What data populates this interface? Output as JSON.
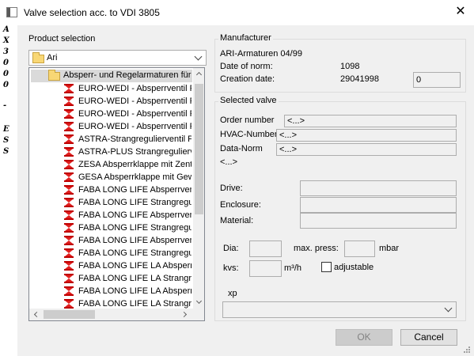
{
  "side_strip": [
    "A",
    "X",
    "3",
    "0",
    "0",
    "0",
    "-",
    "E",
    "S",
    "S"
  ],
  "window": {
    "title": "Valve selection acc. to VDI 3805",
    "close_glyph": "✕"
  },
  "product_selection": {
    "label": "Product selection",
    "combo_value": "Ari",
    "tree": {
      "root": "Absperr- und Regelarmaturen für",
      "items": [
        "EURO-WEDI - Absperrventil P",
        "EURO-WEDI - Absperrventil P",
        "EURO-WEDI - Absperrventil P",
        "EURO-WEDI - Absperrventil P",
        "ASTRA-Strangregulierventil Pl",
        "ASTRA-PLUS Strangregulierve",
        "ZESA Absperrklappe mit Zentr",
        "GESA Absperrklappe mit Gewi",
        "FABA LONG LIFE Absperrvent",
        "FABA LONG LIFE Strangreguli",
        "FABA LONG LIFE Absperrvent",
        "FABA LONG LIFE Strangreguli",
        "FABA LONG LIFE Absperrvent",
        "FABA LONG LIFE Strangreguli",
        "FABA LONG LIFE LA Absperrv",
        "FABA LONG LIFE LA Strangreg",
        "FABA LONG LIFE LA Absperrv",
        "FABA LONG LIFE LA Strangreg"
      ]
    }
  },
  "manufacturer": {
    "label": "Manufacturer",
    "name": "ARI-Armaturen 04/99",
    "date_of_norm_label": "Date of norm:",
    "date_of_norm_value": "1098",
    "creation_date_label": "Creation date:",
    "creation_date_value": "29041998",
    "extra_value": "0"
  },
  "selected_valve": {
    "label": "Selected valve",
    "order_number_label": "Order number",
    "order_number_value": "<...>",
    "hvac_number_label": "HVAC-Number",
    "hvac_number_value": "<...>",
    "data_norm_label": "Data-Norm",
    "data_norm_value": "<...>",
    "extra_value": "<...>",
    "drive_label": "Drive:",
    "drive_value": "",
    "enclosure_label": "Enclosure:",
    "enclosure_value": "",
    "material_label": "Material:",
    "material_value": "",
    "dia_label": "Dia:",
    "dia_value": "",
    "max_press_label": "max. press:",
    "max_press_value": "",
    "max_press_unit": "mbar",
    "kvs_label": "kvs:",
    "kvs_value": "",
    "kvs_unit": "m³/h",
    "adjustable_label": "adjustable",
    "adjustable_checked": false,
    "xp_label": "xp",
    "xp_value": ""
  },
  "buttons": {
    "ok": "OK",
    "cancel": "Cancel"
  }
}
